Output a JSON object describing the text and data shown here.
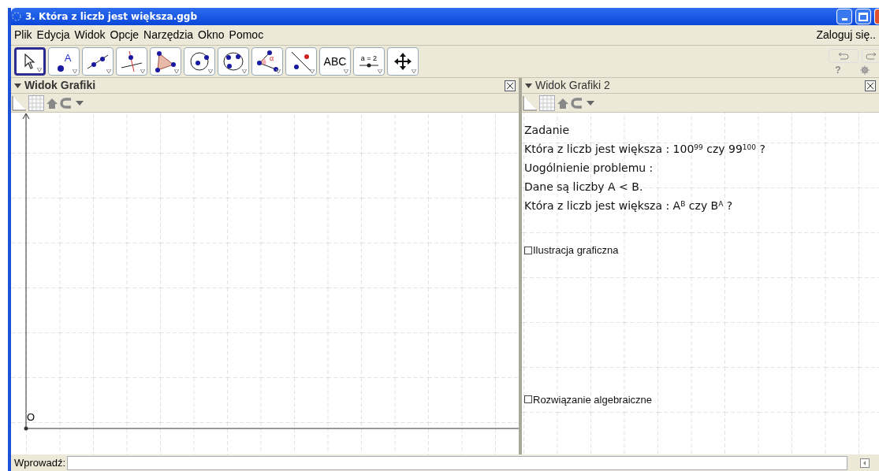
{
  "window": {
    "title": "3. Która z liczb jest większa.ggb"
  },
  "menu": [
    "Plik",
    "Edycja",
    "Widok",
    "Opcje",
    "Narzędzia",
    "Okno",
    "Pomoc"
  ],
  "login": "Zaloguj się..",
  "tools": [
    {
      "kind": "move",
      "selected": true
    },
    {
      "kind": "point",
      "label": "A",
      "selected": false
    },
    {
      "kind": "line",
      "selected": false
    },
    {
      "kind": "perpendicular",
      "selected": false
    },
    {
      "kind": "polygon",
      "selected": false
    },
    {
      "kind": "circle",
      "selected": false
    },
    {
      "kind": "conic",
      "selected": false
    },
    {
      "kind": "angle",
      "label": "α",
      "selected": false
    },
    {
      "kind": "reflect",
      "selected": false
    },
    {
      "kind": "text",
      "label": "ABC",
      "selected": false
    },
    {
      "kind": "slider",
      "label": "a = 2",
      "selected": false
    },
    {
      "kind": "pan",
      "selected": false
    }
  ],
  "help": "?",
  "views": [
    {
      "title": "Widok Grafiki",
      "bold": true,
      "axes": true,
      "origin": "O"
    },
    {
      "title": "Widok Grafiki 2",
      "bold": false,
      "axes": false,
      "texts": [
        {
          "kind": "text",
          "text": "Zadanie"
        },
        {
          "kind": "text",
          "text": "Która z liczb jest większa : 100$^{99}$ czy 99$^{100}$ ?"
        },
        {
          "kind": "text",
          "text": "Uogólnienie problemu :"
        },
        {
          "kind": "text",
          "text": "Dane są liczby A < B."
        },
        {
          "kind": "text",
          "text": "Która z liczb jest większa : A$^{B}$ czy B$^{A}$ ?"
        },
        {
          "kind": "checkbox",
          "text": "Ilustracja graficzna",
          "checked": false
        },
        {
          "kind": "checkbox",
          "text": "Rozwiązanie algebraiczne",
          "checked": false
        }
      ]
    }
  ],
  "input": {
    "label": "Wprowadź:"
  }
}
